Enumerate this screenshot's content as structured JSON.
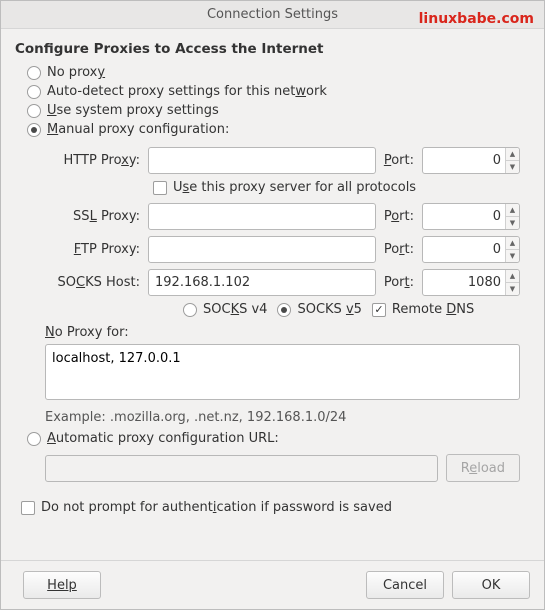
{
  "window": {
    "title": "Connection Settings",
    "watermark": "linuxbabe.com"
  },
  "heading": "Configure Proxies to Access the Internet",
  "radios": {
    "no_proxy": "No proxy",
    "auto_detect": "Auto-detect proxy settings for this network",
    "use_system": "Use system proxy settings",
    "manual": "Manual proxy configuration:",
    "auto_url": "Automatic proxy configuration URL:",
    "selected": "manual"
  },
  "proxies": {
    "http": {
      "label": "HTTP Proxy:",
      "host": "",
      "port_label": "Port:",
      "port": "0"
    },
    "use_for_all": {
      "label": "Use this proxy server for all protocols",
      "checked": false
    },
    "ssl": {
      "label": "SSL Proxy:",
      "host": "",
      "port_label": "Port:",
      "port": "0"
    },
    "ftp": {
      "label": "FTP Proxy:",
      "host": "",
      "port_label": "Port:",
      "port": "0"
    },
    "socks": {
      "label": "SOCKS Host:",
      "host": "192.168.1.102",
      "port_label": "Port:",
      "port": "1080"
    },
    "socks_version": {
      "v4_label": "SOCKS v4",
      "v5_label": "SOCKS v5",
      "selected": "v5",
      "remote_dns": {
        "label": "Remote DNS",
        "checked": true
      }
    }
  },
  "no_proxy": {
    "label": "No Proxy for:",
    "value": "localhost, 127.0.0.1",
    "example": "Example: .mozilla.org, .net.nz, 192.168.1.0/24"
  },
  "pac": {
    "url": "",
    "reload": "Reload"
  },
  "no_prompt": {
    "label": "Do not prompt for authentication if password is saved",
    "checked": false
  },
  "buttons": {
    "help": "Help",
    "cancel": "Cancel",
    "ok": "OK"
  }
}
